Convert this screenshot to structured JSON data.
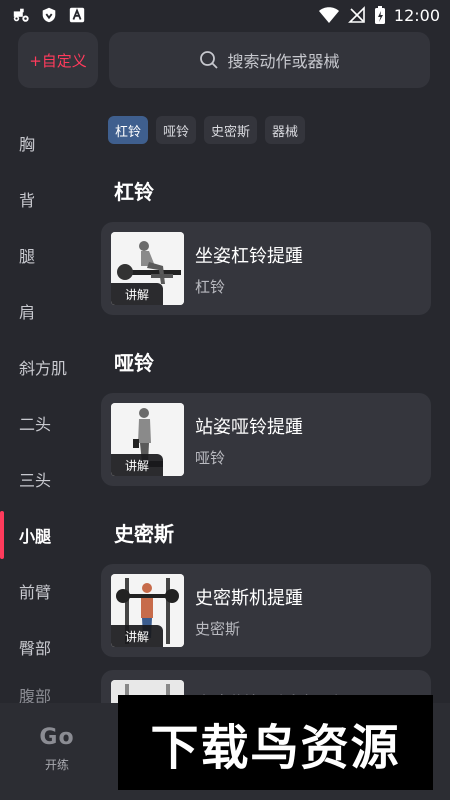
{
  "status_bar": {
    "time": "12:00",
    "left_icons": [
      "tractor-icon",
      "shield-icon",
      "a-square-icon"
    ],
    "right_icons": [
      "wifi-icon",
      "no-signal-icon",
      "battery-charging-icon"
    ]
  },
  "header": {
    "custom_label": "+自定义",
    "search_placeholder": "搜索动作或器械"
  },
  "sidebar": {
    "items": [
      {
        "label": "胸"
      },
      {
        "label": "背"
      },
      {
        "label": "腿"
      },
      {
        "label": "肩"
      },
      {
        "label": "斜方肌"
      },
      {
        "label": "二头"
      },
      {
        "label": "三头"
      },
      {
        "label": "小腿"
      },
      {
        "label": "前臂"
      },
      {
        "label": "臀部"
      },
      {
        "label": "腹部"
      }
    ],
    "active_index": 7
  },
  "filters": {
    "chips": [
      {
        "label": "杠铃",
        "active": true
      },
      {
        "label": "哑铃",
        "active": false
      },
      {
        "label": "史密斯",
        "active": false
      },
      {
        "label": "器械",
        "active": false
      }
    ]
  },
  "sections": [
    {
      "title": "杠铃",
      "exercises": [
        {
          "name": "坐姿杠铃提踵",
          "equipment": "杠铃",
          "tag": "讲解"
        }
      ]
    },
    {
      "title": "哑铃",
      "exercises": [
        {
          "name": "站姿哑铃提踵",
          "equipment": "哑铃",
          "tag": "讲解"
        }
      ]
    },
    {
      "title": "史密斯",
      "exercises": [
        {
          "name": "史密斯机提踵",
          "equipment": "史密斯",
          "tag": "讲解"
        },
        {
          "name": "史密斯机反向提踵",
          "equipment": "",
          "tag": ""
        }
      ]
    }
  ],
  "bottom_nav": {
    "logo": "Go",
    "label": "开练"
  },
  "watermark": {
    "text": "下载鸟资源"
  },
  "colors": {
    "background": "#27282e",
    "card": "#35363d",
    "accent": "#ff3b5c",
    "chip_active": "#3f5f8e"
  }
}
